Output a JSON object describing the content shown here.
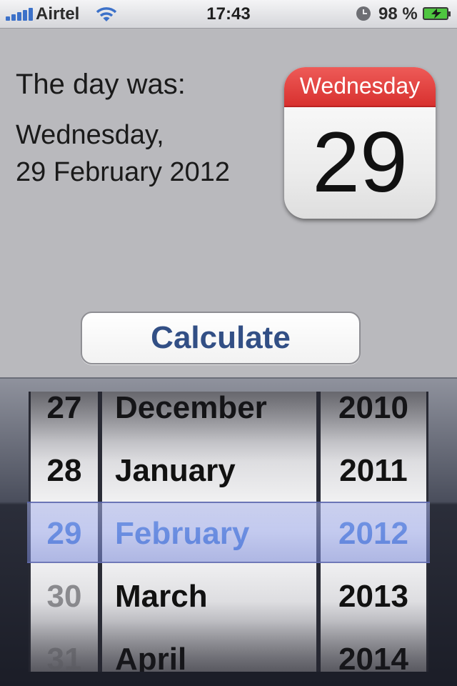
{
  "status_bar": {
    "carrier": "Airtel",
    "time": "17:43",
    "battery": "98 %",
    "icons": [
      "signal-bars-icon",
      "wifi-icon",
      "alarm-clock-icon",
      "battery-charging-icon"
    ]
  },
  "result": {
    "label": "The day was:",
    "line1": "Wednesday,",
    "line2": "29 February 2012"
  },
  "calendar_icon": {
    "weekday": "Wednesday",
    "day": "29",
    "header_color": "#e0403d"
  },
  "calculate_button": {
    "label": "Calculate",
    "text_color": "#324f85"
  },
  "picker": {
    "days": [
      "27",
      "28",
      "29",
      "30",
      "31"
    ],
    "months": [
      "December",
      "January",
      "February",
      "March",
      "April"
    ],
    "years": [
      "2010",
      "2011",
      "2012",
      "2013",
      "2014"
    ],
    "selected_color": "#3c79e0"
  }
}
